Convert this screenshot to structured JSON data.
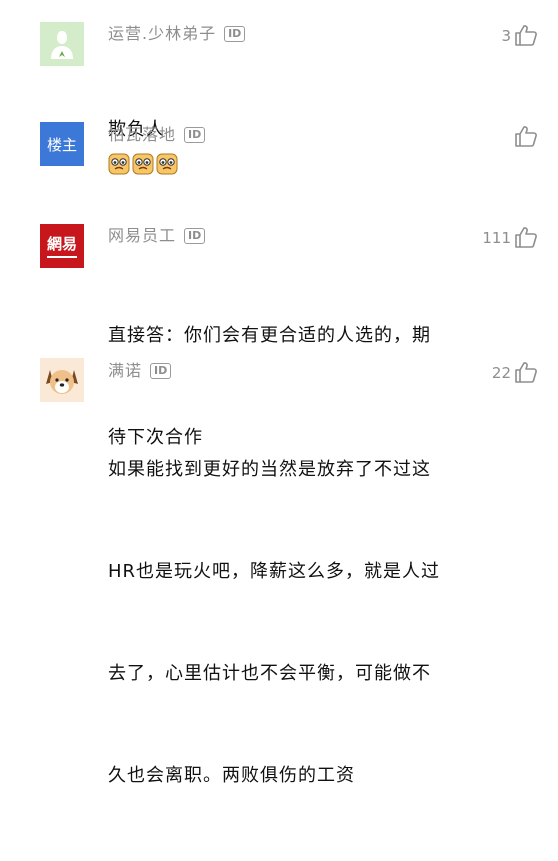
{
  "comments": [
    {
      "username": "运营.少林弟子",
      "id_badge": "ID",
      "likes": "3",
      "lines": [
        "欺负人"
      ],
      "avatar": {
        "type": "user-silhouette",
        "bg": "#d4ecc9",
        "fg": "#6aa84f"
      }
    },
    {
      "username": "怕瓦落地",
      "id_badge": "ID",
      "likes": "",
      "lines": [],
      "emoji_count": 3,
      "avatar": {
        "type": "text",
        "text": "楼主",
        "bg": "#3c78d8",
        "fg": "#ffffff"
      }
    },
    {
      "username": "网易员工",
      "id_badge": "ID",
      "likes": "111",
      "lines": [
        "直接答：你们会有更合适的人选的，期",
        "待下次合作"
      ],
      "avatar": {
        "type": "text",
        "text": "網易",
        "bg": "#c8161d",
        "fg": "#ffffff"
      }
    },
    {
      "username": "满诺",
      "id_badge": "ID",
      "likes": "22",
      "lines": [
        "如果能找到更好的当然是放弃了不过这",
        "HR也是玩火吧，降薪这么多，就是人过",
        "去了，心里估计也不会平衡，可能做不",
        "久也会离职。两败俱伤的工资"
      ],
      "avatar": {
        "type": "dog",
        "bg": "#fbe9d7"
      }
    }
  ],
  "colors": {
    "meta": "#8e8e8e",
    "text": "#111111"
  }
}
